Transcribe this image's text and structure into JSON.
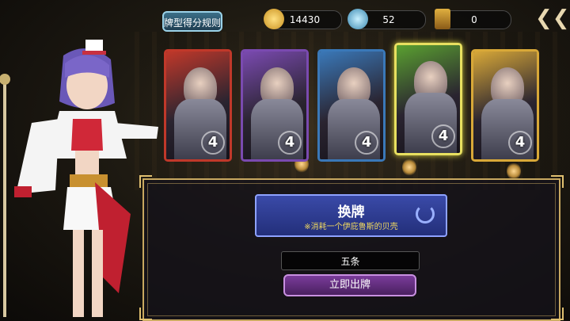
{
  "top_bar": {
    "rules_label": "牌型得分规则",
    "gold": "14430",
    "crystals": "52",
    "cards_owned": "0",
    "icons": [
      "gold-coin-icon",
      "crystal-icon",
      "card-ticket-icon",
      "back-arrow-icon"
    ]
  },
  "cards": [
    {
      "name": "hooded-rogue",
      "value": "4",
      "frame_color": "#c0382a"
    },
    {
      "name": "werewolf",
      "value": "4",
      "frame_color": "#7a4ab0"
    },
    {
      "name": "blue-haired-knight",
      "value": "4",
      "frame_color": "#3a78b8"
    },
    {
      "name": "armored-knight",
      "value": "4",
      "frame_color": "#5aa030",
      "selected": true
    },
    {
      "name": "blonde-priest",
      "value": "4",
      "frame_color": "#d8a838"
    }
  ],
  "panel": {
    "swap_title": "换牌",
    "swap_cost": "※消耗一个伊庇鲁斯的贝壳",
    "hand_type": "五条",
    "play_label": "立即出牌"
  },
  "colors": {
    "accent_gold": "#c8a860",
    "swap_blue": "#2a3890",
    "play_purple": "#5a2a78"
  }
}
